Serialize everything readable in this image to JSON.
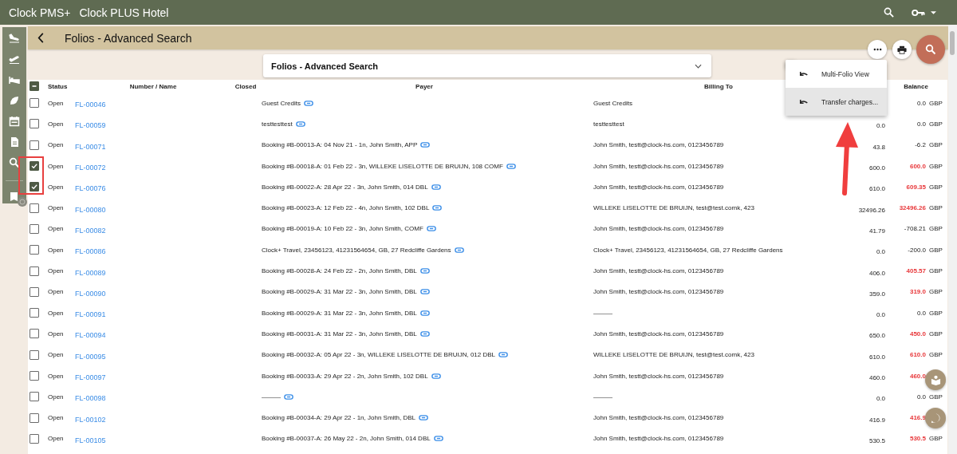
{
  "app_bar": {
    "app_name": "Clock PMS+",
    "property": "Clock PLUS Hotel"
  },
  "page_header": {
    "title": "Folios - Advanced Search"
  },
  "search_panel": {
    "title": "Folios - Advanced Search",
    "expanded": false
  },
  "menu": {
    "items": [
      {
        "label": "Multi-Folio View",
        "selected": false
      },
      {
        "label": "Transfer charges...",
        "selected": true
      }
    ]
  },
  "table": {
    "select_all": {
      "indeterminate": true
    },
    "columns": [
      "Status",
      "Number / Name",
      "Closed",
      "Payer",
      "Billing To",
      "Balance"
    ],
    "rows": [
      {
        "checked": false,
        "status": "Open",
        "number": "FL-00046",
        "payer": "Guest Credits",
        "billing_to": "Guest Credits",
        "balance": "0.0",
        "currency": "GBP",
        "due": false
      },
      {
        "checked": false,
        "status": "Open",
        "number": "FL-00059",
        "payer": "testtesttest",
        "billing_to": "testtesttest",
        "column_7": "0.0",
        "balance": "0.0",
        "currency": "GBP",
        "due": false
      },
      {
        "checked": false,
        "status": "Open",
        "number": "FL-00071",
        "payer": "Booking #B-00013-A: 04 Nov 21 - 1n, John Smith, APP",
        "billing_to": "John Smith, testt@clock-hs.com, 0123456789",
        "column_7": "43.8",
        "balance": "-6.2",
        "currency": "GBP",
        "due": false
      },
      {
        "checked": true,
        "status": "Open",
        "number": "FL-00072",
        "payer": "Booking #B-00018-A: 01 Feb 22 - 3n, WILLEKE LISELOTTE DE BRUIJN, 108 COMF",
        "billing_to": "John Smith, testt@clock-hs.com, 0123456789",
        "column_7": "600.0",
        "balance": "600.0",
        "currency": "GBP",
        "due": true
      },
      {
        "checked": true,
        "status": "Open",
        "number": "FL-00076",
        "payer": "Booking #B-00022-A: 28 Apr 22 - 3n, John Smith, 014 DBL",
        "billing_to": "John Smith, testt@clock-hs.com, 0123456789",
        "column_7": "610.0",
        "balance": "609.35",
        "currency": "GBP",
        "due": true
      },
      {
        "checked": false,
        "status": "Open",
        "number": "FL-00080",
        "payer": "Booking #B-00023-A: 12 Feb 22 - 4n, John Smith, 102 DBL",
        "billing_to": "WILLEKE LISELOTTE DE BRUIJN, test@test.comk, 423",
        "column_7": "32496.26",
        "balance": "32496.26",
        "currency": "GBP",
        "due": true
      },
      {
        "checked": false,
        "status": "Open",
        "number": "FL-00082",
        "payer": "Booking #B-00019-A: 10 Feb 22 - 3n, John Smith, COMF",
        "billing_to": "John Smith, testt@clock-hs.com, 0123456789",
        "column_7": "41.79",
        "balance": "-708.21",
        "currency": "GBP",
        "due": false
      },
      {
        "checked": false,
        "status": "Open",
        "number": "FL-00086",
        "payer": "Clock+ Travel, 23456123, 41231564654, GB, 27 Redcliffe Gardens",
        "billing_to": "Clock+ Travel, 23456123, 41231564654, GB, 27 Redcliffe Gardens",
        "column_7": "0.0",
        "balance": "-200.0",
        "currency": "GBP",
        "due": false
      },
      {
        "checked": false,
        "status": "Open",
        "number": "FL-00089",
        "payer": "Booking #B-00028-A: 24 Feb 22 - 2n, John Smith, DBL",
        "billing_to": "John Smith, testt@clock-hs.com, 0123456789",
        "column_7": "406.0",
        "balance": "405.57",
        "currency": "GBP",
        "due": true
      },
      {
        "checked": false,
        "status": "Open",
        "number": "FL-00090",
        "payer": "Booking #B-00029-A: 31 Mar 22 - 3n, John Smith, DBL",
        "billing_to": "John Smith, testt@clock-hs.com, 0123456789",
        "column_7": "359.0",
        "balance": "319.0",
        "currency": "GBP",
        "due": true
      },
      {
        "checked": false,
        "status": "Open",
        "number": "FL-00091",
        "payer": "Booking #B-00029-A: 31 Mar 22 - 3n, John Smith, DBL",
        "billing_to": "———",
        "column_7": "0.0",
        "balance": "0.0",
        "currency": "GBP",
        "due": false
      },
      {
        "checked": false,
        "status": "Open",
        "number": "FL-00094",
        "payer": "Booking #B-00031-A: 31 Mar 22 - 3n, John Smith, DBL",
        "billing_to": "John Smith, testt@clock-hs.com, 0123456789",
        "column_7": "650.0",
        "balance": "450.0",
        "currency": "GBP",
        "due": true
      },
      {
        "checked": false,
        "status": "Open",
        "number": "FL-00095",
        "payer": "Booking #B-00032-A: 05 Apr 22 - 3n, WILLEKE LISELOTTE DE BRUIJN, 012 DBL",
        "billing_to": "WILLEKE LISELOTTE DE BRUIJN, test@test.comk, 423",
        "column_7": "610.0",
        "balance": "610.0",
        "currency": "GBP",
        "due": true
      },
      {
        "checked": false,
        "status": "Open",
        "number": "FL-00097",
        "payer": "Booking #B-00033-A: 29 Apr 22 - 2n, John Smith, 102 DBL",
        "billing_to": "John Smith, testt@clock-hs.com, 0123456789",
        "column_7": "460.0",
        "balance": "460.0",
        "due": true
      },
      {
        "checked": false,
        "status": "Open",
        "number": "FL-00098",
        "payer": "———",
        "billing_to": "———",
        "column_7": "0.0",
        "balance": "0.0",
        "currency": "GBP",
        "due": false
      },
      {
        "checked": false,
        "status": "Open",
        "number": "FL-00102",
        "payer": "Booking #B-00034-A: 29 Apr 22 - 1n, John Smith, DBL",
        "billing_to": "John Smith, testt@clock-hs.com, 0123456789",
        "column_7": "416.9",
        "balance": "416.9",
        "due": true
      },
      {
        "checked": false,
        "status": "Open",
        "number": "FL-00105",
        "payer": "Booking #B-00037-A: 26 May 22 - 2n, John Smith, 014 DBL",
        "billing_to": "John Smith, testt@clock-hs.com, 0123456789",
        "column_7": "530.5",
        "balance": "530.5",
        "currency": "GBP",
        "due": true
      }
    ]
  }
}
